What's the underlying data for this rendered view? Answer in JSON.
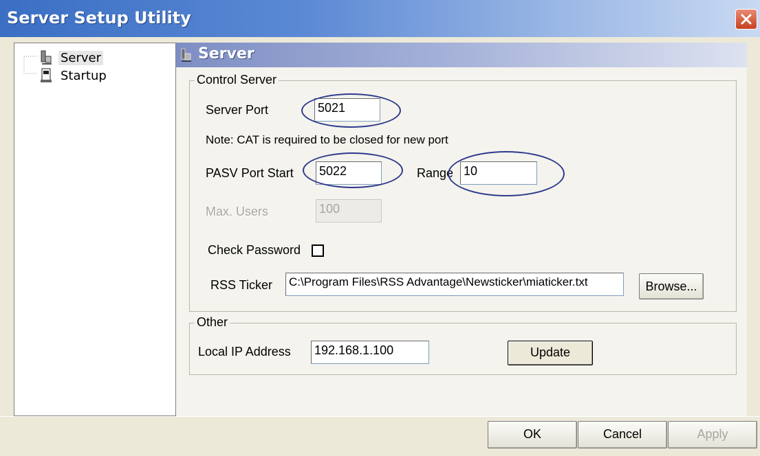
{
  "window": {
    "title": "Server Setup Utility",
    "close_icon": "close-icon"
  },
  "tree": {
    "items": [
      {
        "label": "Server",
        "icon": "server-tree-icon",
        "selected": true
      },
      {
        "label": "Startup",
        "icon": "startup-tree-icon",
        "selected": false
      }
    ]
  },
  "page": {
    "title": "Server"
  },
  "control_server": {
    "legend": "Control Server",
    "server_port_label": "Server Port",
    "server_port_value": "5021",
    "note": "Note: CAT is required to be closed  for new port",
    "pasv_port_start_label": "PASV Port Start",
    "pasv_port_start_value": "5022",
    "range_label": "Range",
    "range_value": "10",
    "max_users_label": "Max. Users",
    "max_users_value": "100",
    "check_password_label": "Check Password",
    "check_password_checked": false,
    "rss_ticker_label": "RSS Ticker",
    "rss_ticker_value": "C:\\Program Files\\RSS Advantage\\Newsticker\\miaticker.txt",
    "browse_label": "Browse..."
  },
  "other": {
    "legend": "Other",
    "local_ip_label": "Local IP Address",
    "local_ip_value": "192.168.1.100",
    "update_label": "Update"
  },
  "buttons": {
    "ok": "OK",
    "cancel": "Cancel",
    "apply": "Apply"
  },
  "colors": {
    "annotation_ellipse": "#2d3a8c",
    "titlebar": "#3a6fc4"
  }
}
